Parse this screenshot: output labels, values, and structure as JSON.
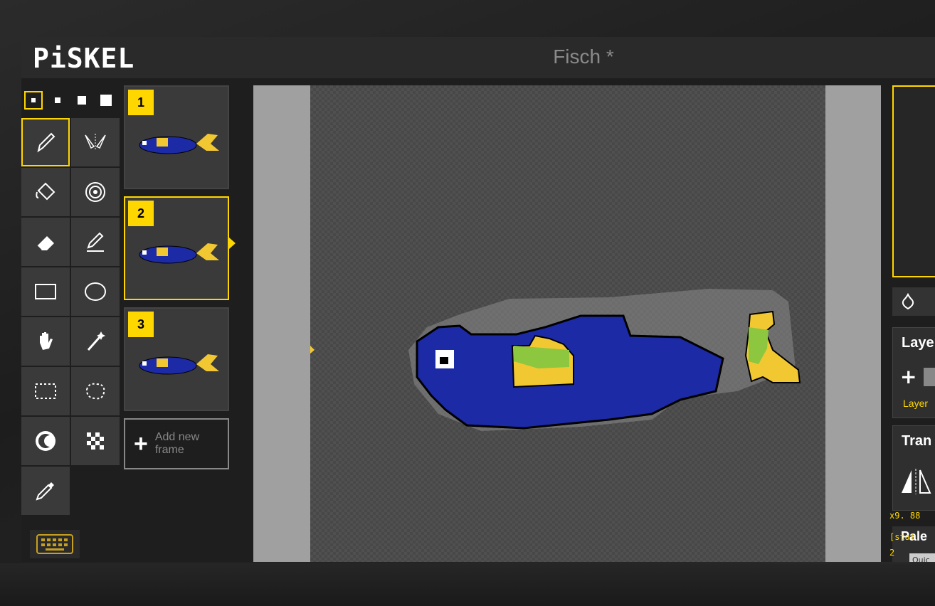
{
  "app": {
    "logo": "PiSKEL",
    "title": "Fisch *"
  },
  "pen_sizes": [
    "1",
    "2",
    "3",
    "4"
  ],
  "tools": [
    "pen",
    "vertical-mirror-pen",
    "paint-bucket",
    "paint-all-same-color",
    "eraser",
    "stroke",
    "rectangle",
    "circle",
    "move",
    "shape-selection",
    "rectangle-selection",
    "lasso-selection",
    "lighten",
    "dithering",
    "color-picker"
  ],
  "frames": [
    {
      "number": "1",
      "active": false
    },
    {
      "number": "2",
      "active": true
    },
    {
      "number": "3",
      "active": false
    }
  ],
  "add_frame": {
    "line1": "Add new",
    "line2": "frame"
  },
  "right_panel": {
    "layers_title": "Laye",
    "layer_name": "Layer",
    "transform_title": "Tran",
    "palettes_title": "Pale",
    "quick_label": "Quic",
    "coord_text": "x9. 88",
    "status_line2": "[stat",
    "status_line3": "2"
  },
  "colors": {
    "accent": "#ffd700",
    "fish_body": "#1c2aa6",
    "fish_fin": "#f2c832",
    "fish_green": "#8dc63f"
  }
}
